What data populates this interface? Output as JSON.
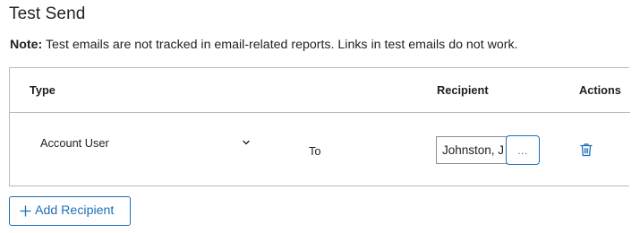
{
  "section": {
    "title": "Test Send",
    "note_label": "Note:",
    "note_text": " Test emails are not tracked in email-related reports. Links in test emails do not work."
  },
  "table": {
    "columns": {
      "type": "Type",
      "recipient": "Recipient",
      "actions": "Actions"
    },
    "rows": [
      {
        "type_value": "Account User",
        "to_label": "To",
        "recipient_value": "Johnston, J",
        "browse_label": "...",
        "delete_icon": "trash-icon"
      }
    ]
  },
  "add_recipient": {
    "label": "Add Recipient",
    "icon": "plus-icon"
  },
  "colors": {
    "accent": "#1f6fb8",
    "border": "#b9b9b9",
    "text": "#1f1f1f"
  }
}
